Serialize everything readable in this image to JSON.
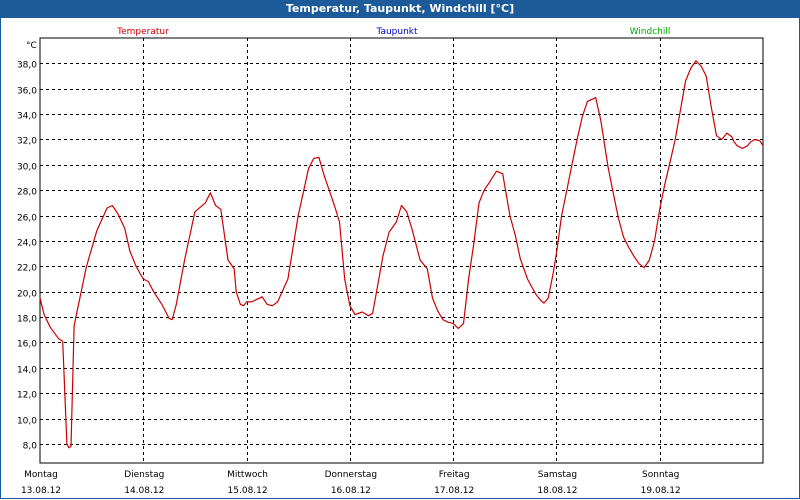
{
  "window": {
    "title": "Temperatur, Taupunkt, Windchill [°C]"
  },
  "chart_data": {
    "type": "line",
    "ylabel": "°C",
    "ylim": [
      6.5,
      40.0
    ],
    "yticks": [
      8.0,
      10.0,
      12.0,
      14.0,
      16.0,
      18.0,
      20.0,
      22.0,
      24.0,
      26.0,
      28.0,
      30.0,
      32.0,
      34.0,
      36.0,
      38.0
    ],
    "ytick_labels": [
      "8,0",
      "10,0",
      "12,0",
      "14,0",
      "16,0",
      "18,0",
      "20,0",
      "22,0",
      "24,0",
      "26,0",
      "28,0",
      "30,0",
      "32,0",
      "34,0",
      "36,0",
      "38,0"
    ],
    "xlim": [
      0,
      7
    ],
    "day_labels": [
      {
        "weekday": "Montag",
        "date": "13.08.12"
      },
      {
        "weekday": "Dienstag",
        "date": "14.08.12"
      },
      {
        "weekday": "Mittwoch",
        "date": "15.08.12"
      },
      {
        "weekday": "Donnerstag",
        "date": "16.08.12"
      },
      {
        "weekday": "Freitag",
        "date": "17.08.12"
      },
      {
        "weekday": "Samstag",
        "date": "18.08.12"
      },
      {
        "weekday": "Sonntag",
        "date": "19.08.12"
      }
    ],
    "grid": true,
    "legend_position": "top",
    "series": [
      {
        "name": "Temperatur",
        "color": "#cc0000",
        "x": [
          0.0,
          0.04,
          0.1,
          0.18,
          0.22,
          0.26,
          0.28,
          0.3,
          0.33,
          0.36,
          0.45,
          0.55,
          0.65,
          0.7,
          0.75,
          0.82,
          0.87,
          0.93,
          1.0,
          1.05,
          1.1,
          1.18,
          1.25,
          1.28,
          1.32,
          1.4,
          1.5,
          1.6,
          1.65,
          1.7,
          1.75,
          1.82,
          1.88,
          1.9,
          1.94,
          1.97,
          2.0,
          2.05,
          2.1,
          2.15,
          2.2,
          2.25,
          2.3,
          2.4,
          2.5,
          2.6,
          2.65,
          2.7,
          2.75,
          2.8,
          2.85,
          2.9,
          2.95,
          3.0,
          3.05,
          3.12,
          3.18,
          3.22,
          3.27,
          3.32,
          3.38,
          3.45,
          3.5,
          3.55,
          3.6,
          3.68,
          3.75,
          3.8,
          3.85,
          3.9,
          3.95,
          4.0,
          4.05,
          4.1,
          4.15,
          4.2,
          4.25,
          4.3,
          4.35,
          4.38,
          4.42,
          4.48,
          4.55,
          4.6,
          4.65,
          4.72,
          4.8,
          4.85,
          4.88,
          4.92,
          4.97,
          5.0,
          5.05,
          5.1,
          5.15,
          5.2,
          5.25,
          5.3,
          5.38,
          5.43,
          5.5,
          5.55,
          5.6,
          5.65,
          5.7,
          5.75,
          5.8,
          5.85,
          5.9,
          5.95,
          6.0,
          6.05,
          6.1,
          6.15,
          6.2,
          6.25,
          6.3,
          6.35,
          6.4,
          6.45,
          6.5,
          6.55,
          6.6,
          6.65,
          6.7,
          6.72,
          6.75,
          6.8,
          6.85,
          6.88,
          6.92,
          6.97,
          7.0
        ],
        "y": [
          19.5,
          18.2,
          17.2,
          16.3,
          16.1,
          8.0,
          7.7,
          7.8,
          17.3,
          18.5,
          22.0,
          24.8,
          26.6,
          26.8,
          26.2,
          25.0,
          23.2,
          22.0,
          21.0,
          20.8,
          20.0,
          19.0,
          17.9,
          17.8,
          19.0,
          22.5,
          26.3,
          27.0,
          27.8,
          26.8,
          26.5,
          22.5,
          21.8,
          20.0,
          19.0,
          18.9,
          19.2,
          19.2,
          19.4,
          19.6,
          19.0,
          18.9,
          19.2,
          21.0,
          26.0,
          29.7,
          30.5,
          30.6,
          29.2,
          28.0,
          26.8,
          25.5,
          21.0,
          18.9,
          18.2,
          18.4,
          18.1,
          18.3,
          20.5,
          22.8,
          24.7,
          25.5,
          26.8,
          26.3,
          25.0,
          22.5,
          21.8,
          19.5,
          18.5,
          17.8,
          17.6,
          17.5,
          17.1,
          17.5,
          21.0,
          23.8,
          27.0,
          28.0,
          28.6,
          29.0,
          29.5,
          29.3,
          26.0,
          24.5,
          22.6,
          21.0,
          19.8,
          19.3,
          19.1,
          19.5,
          21.5,
          23.0,
          26.0,
          28.0,
          30.0,
          32.0,
          33.8,
          35.0,
          35.3,
          33.5,
          29.8,
          27.8,
          25.8,
          24.3,
          23.5,
          22.8,
          22.2,
          21.9,
          22.5,
          24.0,
          26.5,
          28.5,
          30.2,
          32.0,
          34.3,
          36.6,
          37.6,
          38.2,
          37.8,
          37.0,
          34.5,
          32.3,
          32.0,
          32.5,
          32.2,
          31.8,
          31.5,
          31.3,
          31.5,
          31.8,
          32.0,
          31.9,
          31.5
        ]
      },
      {
        "name": "Taupunkt",
        "color": "#0000cc"
      },
      {
        "name": "Windchill",
        "color": "#00aa00"
      }
    ]
  }
}
